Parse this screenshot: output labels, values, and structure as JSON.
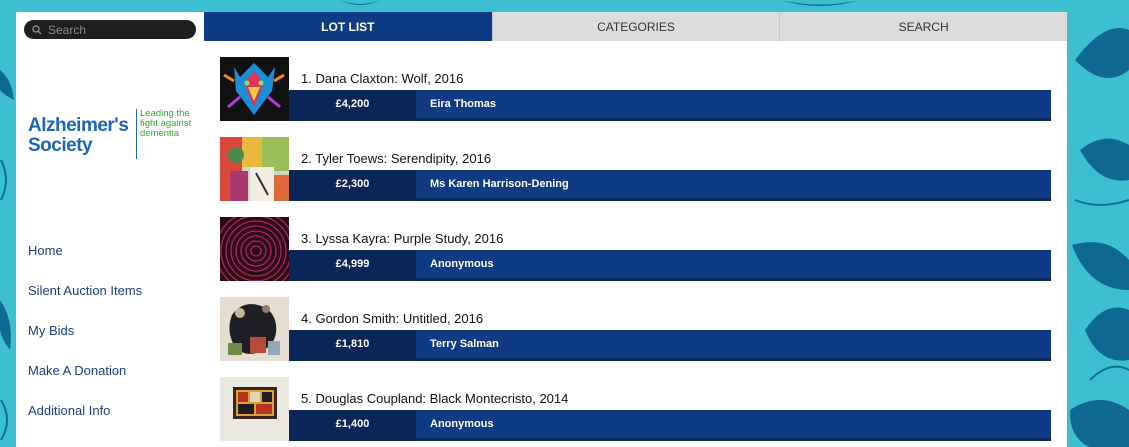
{
  "search": {
    "placeholder": "Search"
  },
  "logo": {
    "name_line1": "Alzheimer's",
    "name_line2": "Society",
    "tagline_line1": "Leading the",
    "tagline_line2": "fight against",
    "tagline_line3": "dementia"
  },
  "nav": [
    {
      "label": "Home"
    },
    {
      "label": "Silent Auction Items"
    },
    {
      "label": "My Bids"
    },
    {
      "label": "Make A Donation"
    },
    {
      "label": "Additional Info"
    }
  ],
  "tabs": [
    {
      "label": "LOT LIST",
      "active": true
    },
    {
      "label": "CATEGORIES",
      "active": false
    },
    {
      "label": "SEARCH",
      "active": false
    }
  ],
  "lots": [
    {
      "title": "1. Dana Claxton: Wolf, 2016",
      "price": "£4,200",
      "bidder": "Eira Thomas"
    },
    {
      "title": "2. Tyler Toews: Serendipity, 2016",
      "price": "£2,300",
      "bidder": "Ms Karen Harrison-Dening"
    },
    {
      "title": "3. Lyssa Kayra: Purple Study, 2016",
      "price": "£4,999",
      "bidder": "Anonymous"
    },
    {
      "title": "4. Gordon Smith: Untitled, 2016",
      "price": "£1,810",
      "bidder": "Terry Salman"
    },
    {
      "title": "5. Douglas Coupland: Black Montecristo, 2014",
      "price": "£1,400",
      "bidder": "Anonymous"
    }
  ],
  "colors": {
    "background": "#3cc0cf",
    "brand_navy": "#0f3a84",
    "logo_blue": "#1a66b8",
    "logo_green": "#2ea836"
  }
}
